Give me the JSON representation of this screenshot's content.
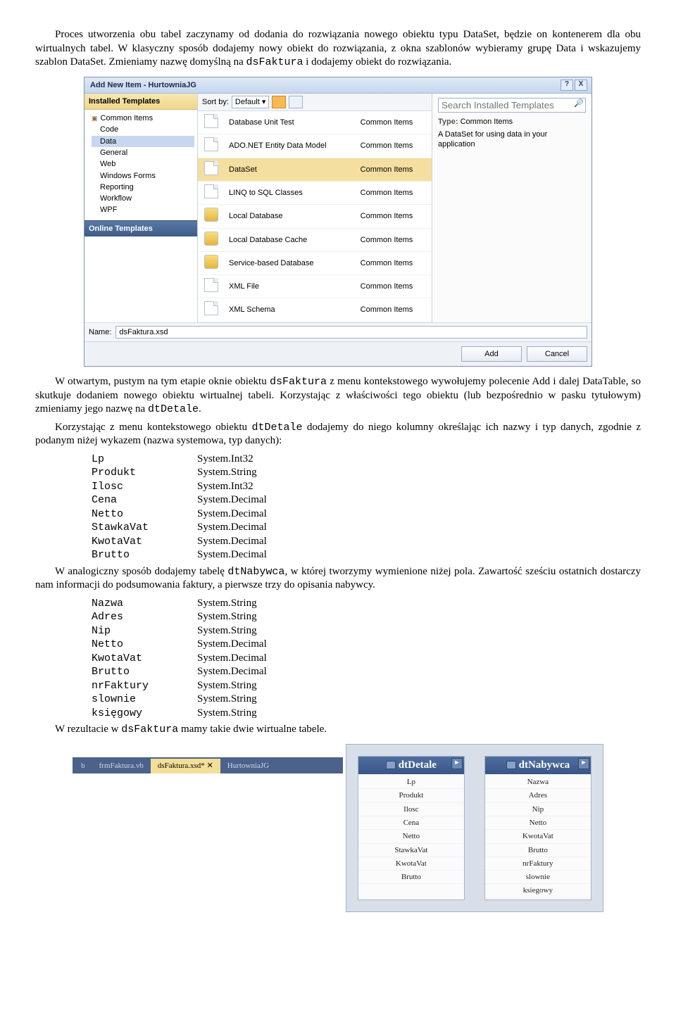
{
  "para1": "Proces utworzenia obu tabel zaczynamy od dodania do rozwiązania nowego obiektu typu DataSet, będzie on kontenerem dla obu wirtualnych tabel. W klasyczny sposób dodajemy nowy obiekt do rozwiązania, z okna szablonów wybieramy grupę Data i wskazujemy szablon DataSet. Zmieniamy nazwę domyślną na ",
  "para1_code": "dsFaktura",
  "para1_tail": " i dodajemy obiekt do rozwiązania.",
  "dialog": {
    "title": "Add New Item - HurtowniaJG",
    "help": "?",
    "close": "X",
    "installed_hdr": "Installed Templates",
    "online_hdr": "Online Templates",
    "tree_root": "Common Items",
    "tree": [
      "Code",
      "Data",
      "General",
      "Web",
      "Windows Forms",
      "Reporting",
      "Workflow",
      "WPF"
    ],
    "tree_sel": "Data",
    "sortby": "Sort by:",
    "sortval": "Default",
    "search_ph": "Search Installed Templates",
    "items": [
      {
        "name": "Database Unit Test",
        "type": "Common Items",
        "icon": "file"
      },
      {
        "name": "ADO.NET Entity Data Model",
        "type": "Common Items",
        "icon": "file"
      },
      {
        "name": "DataSet",
        "type": "Common Items",
        "icon": "file",
        "sel": true
      },
      {
        "name": "LINQ to SQL Classes",
        "type": "Common Items",
        "icon": "file"
      },
      {
        "name": "Local Database",
        "type": "Common Items",
        "icon": "db"
      },
      {
        "name": "Local Database Cache",
        "type": "Common Items",
        "icon": "db"
      },
      {
        "name": "Service-based Database",
        "type": "Common Items",
        "icon": "db"
      },
      {
        "name": "XML File",
        "type": "Common Items",
        "icon": "file"
      },
      {
        "name": "XML Schema",
        "type": "Common Items",
        "icon": "file"
      }
    ],
    "rp_type_lbl": "Type:",
    "rp_type_val": "Common Items",
    "rp_desc": "A DataSet for using data in your application",
    "name_lbl": "Name:",
    "name_val": "dsFaktura.xsd",
    "add": "Add",
    "cancel": "Cancel"
  },
  "para2a": "W otwartym, pustym na tym etapie oknie obiektu ",
  "para2b": "dsFaktura",
  "para2c": " z menu kontekstowego wywołujemy polecenie Add i dalej DataTable, so skutkuje dodaniem nowego obiektu wirtualnej tabeli. Korzystając z właściwości tego obiektu (lub bezpośrednio w pasku tytułowym) zmieniamy jego nazwę na ",
  "para2d": "dtDetale",
  "para2e": ".",
  "para3a": "Korzystając z menu kontekstowego obiektu ",
  "para3b": "dtDetale",
  "para3c": " dodajemy do niego kolumny określając ich nazwy i typ danych, zgodnie z podanym niżej wykazem (nazwa systemowa, typ danych):",
  "cols1": [
    {
      "n": "Lp",
      "t": "System.Int32"
    },
    {
      "n": "Produkt",
      "t": "System.String"
    },
    {
      "n": "Ilosc",
      "t": "System.Int32"
    },
    {
      "n": "Cena",
      "t": "System.Decimal"
    },
    {
      "n": "Netto",
      "t": "System.Decimal"
    },
    {
      "n": "StawkaVat",
      "t": "System.Decimal"
    },
    {
      "n": "KwotaVat",
      "t": "System.Decimal"
    },
    {
      "n": "Brutto",
      "t": "System.Decimal"
    }
  ],
  "para4a": "W analogiczny sposób dodajemy tabelę ",
  "para4b": "dtNabywca",
  "para4c": ", w której tworzymy wymienione niżej pola. Zawartość sześciu ostatnich dostarczy nam informacji do podsumowania faktury, a pierwsze trzy do opisania nabywcy.",
  "cols2": [
    {
      "n": "Nazwa",
      "t": "System.String"
    },
    {
      "n": "Adres",
      "t": "System.String"
    },
    {
      "n": "Nip",
      "t": "System.String"
    },
    {
      "n": "Netto",
      "t": "System.Decimal"
    },
    {
      "n": "KwotaVat",
      "t": "System.Decimal"
    },
    {
      "n": "Brutto",
      "t": "System.Decimal"
    },
    {
      "n": "nrFaktury",
      "t": "System.String"
    },
    {
      "n": "slownie",
      "t": "System.String"
    },
    {
      "n": "księgowy",
      "t": "System.String"
    }
  ],
  "para5a": "W rezultacie w ",
  "para5b": "dsFaktura",
  "para5c": " mamy takie dwie wirtualne tabele.",
  "fig2": {
    "tabs": [
      "b",
      "frmFaktura.vb",
      "dsFaktura.xsd*",
      "HurtowniaJG"
    ],
    "active": "dsFaktura.xsd*",
    "t1": {
      "name": "dtDetale",
      "cols": [
        "Lp",
        "Produkt",
        "Ilosc",
        "Cena",
        "Netto",
        "StawkaVat",
        "KwotaVat",
        "Brutto"
      ]
    },
    "t2": {
      "name": "dtNabywca",
      "cols": [
        "Nazwa",
        "Adres",
        "Nip",
        "Netto",
        "KwotaVat",
        "Brutto",
        "nrFaktury",
        "slownie",
        "ksiegowy"
      ]
    }
  }
}
